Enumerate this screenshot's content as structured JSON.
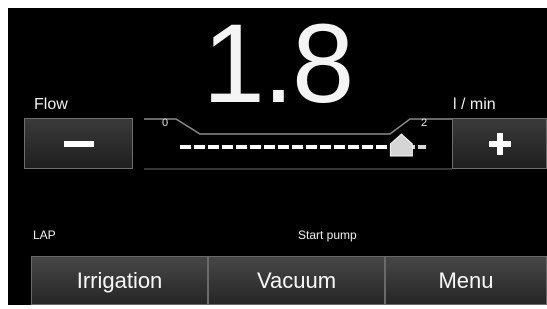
{
  "flow": {
    "label": "Flow",
    "value": "1.8",
    "unit": "l / min"
  },
  "slider": {
    "min_label": "0",
    "max_label": "2",
    "min": 0,
    "max": 2,
    "value": 1.8
  },
  "controls": {
    "decrease_icon": "minus-icon",
    "increase_icon": "plus-icon"
  },
  "status": {
    "mode": "LAP",
    "message": "Start pump"
  },
  "bottom_menu": {
    "irrigation_label": "Irrigation",
    "vacuum_label": "Vacuum",
    "menu_label": "Menu"
  },
  "colors": {
    "background": "#000000",
    "text": "#f0f0f0",
    "button_border": "#6e6e6e"
  }
}
